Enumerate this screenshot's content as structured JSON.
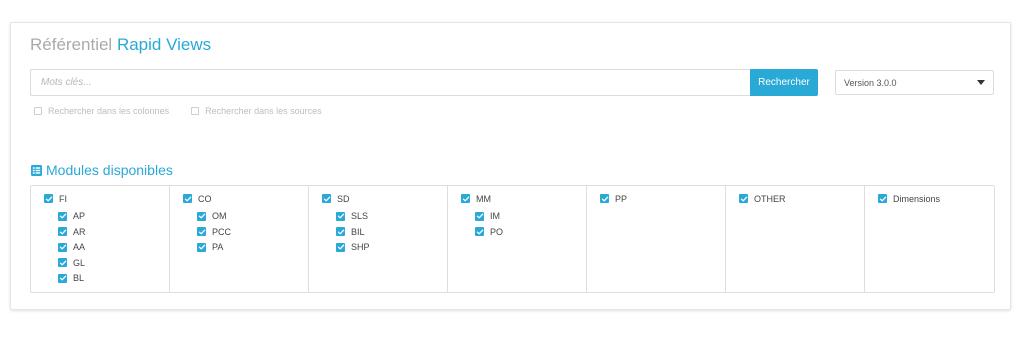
{
  "header": {
    "title_prefix": "Référentiel",
    "title_main": "Rapid Views"
  },
  "search": {
    "placeholder": "Mots clés...",
    "value": "",
    "button_label": "Rechercher"
  },
  "version": {
    "selected": "Version 3.0.0"
  },
  "options": {
    "columns_label": "Rechercher dans les colonnes",
    "sources_label": "Rechercher dans les sources"
  },
  "modules": {
    "title": "Modules disponibles",
    "groups": [
      {
        "label": "FI",
        "checked": true,
        "children": [
          {
            "label": "AP",
            "checked": true
          },
          {
            "label": "AR",
            "checked": true
          },
          {
            "label": "AA",
            "checked": true
          },
          {
            "label": "GL",
            "checked": true
          },
          {
            "label": "BL",
            "checked": true
          }
        ]
      },
      {
        "label": "CO",
        "checked": true,
        "children": [
          {
            "label": "OM",
            "checked": true
          },
          {
            "label": "PCC",
            "checked": true
          },
          {
            "label": "PA",
            "checked": true
          }
        ]
      },
      {
        "label": "SD",
        "checked": true,
        "children": [
          {
            "label": "SLS",
            "checked": true
          },
          {
            "label": "BIL",
            "checked": true
          },
          {
            "label": "SHP",
            "checked": true
          }
        ]
      },
      {
        "label": "MM",
        "checked": true,
        "children": [
          {
            "label": "IM",
            "checked": true
          },
          {
            "label": "PO",
            "checked": true
          }
        ]
      },
      {
        "label": "PP",
        "checked": true,
        "children": []
      },
      {
        "label": "OTHER",
        "checked": true,
        "children": []
      },
      {
        "label": "Dimensions",
        "checked": true,
        "children": []
      }
    ]
  },
  "colors": {
    "accent": "#29a9d6",
    "muted_text": "#aaaaaa"
  },
  "icons": {
    "modules": "list-icon",
    "checkbox": "check-icon",
    "dropdown": "chevron-down-icon"
  }
}
